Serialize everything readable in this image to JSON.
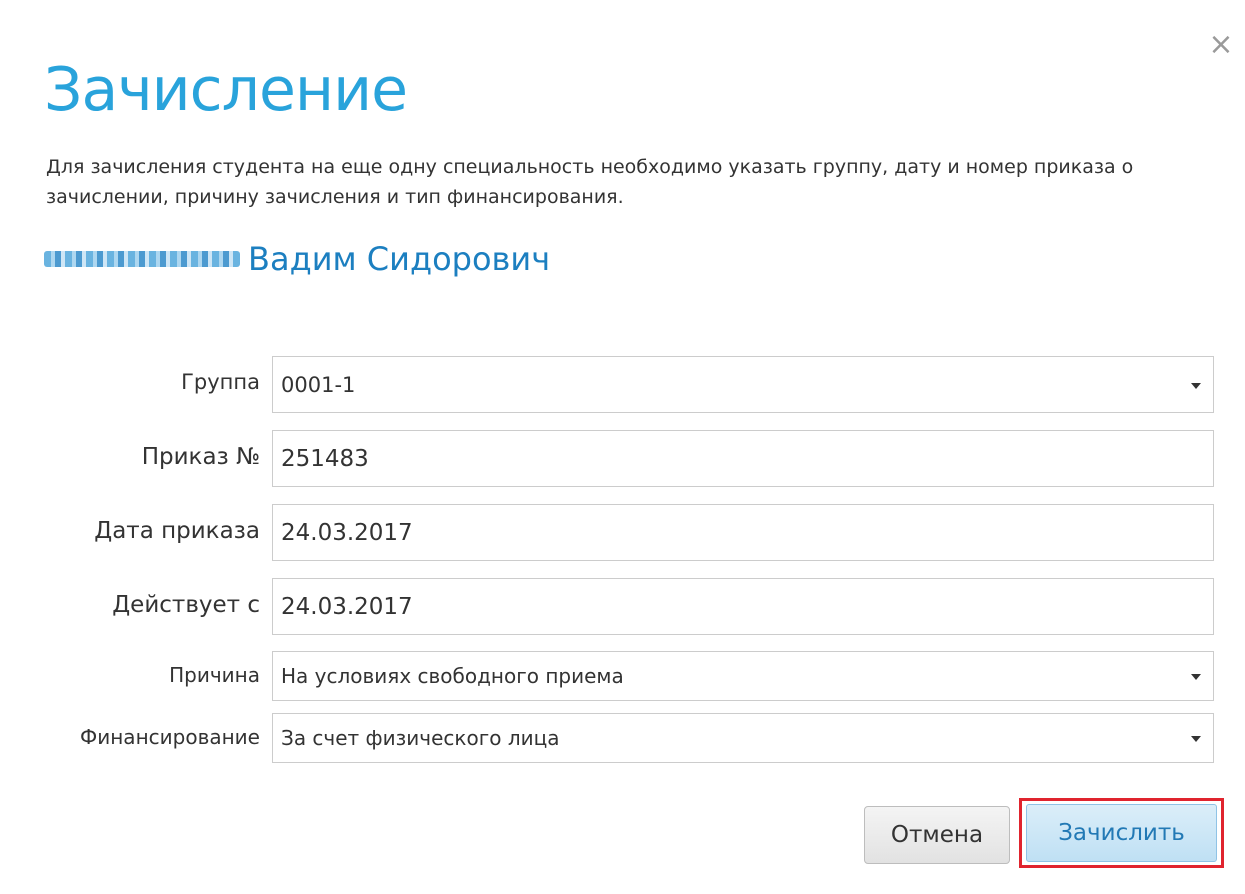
{
  "dialog": {
    "close_label": "×",
    "title": "Зачисление",
    "description": "Для зачисления студента на еще одну специальность необходимо указать группу, дату и номер приказа о зачислении, причину зачисления и тип финансирования.",
    "student_name": "Вадим Сидорович"
  },
  "form": {
    "group": {
      "label": "Группа",
      "value": "0001-1"
    },
    "order_number": {
      "label": "Приказ №",
      "value": "251483"
    },
    "order_date": {
      "label": "Дата приказа",
      "value": "24.03.2017"
    },
    "effective_from": {
      "label": "Действует с",
      "value": "24.03.2017"
    },
    "reason": {
      "label": "Причина",
      "value": "На условиях свободного приема"
    },
    "funding": {
      "label": "Финансирование",
      "value": "За счет физического лица"
    }
  },
  "buttons": {
    "cancel_label": "Отмена",
    "submit_label": "Зачислить"
  },
  "colors": {
    "title": "#29a3db",
    "name": "#1c7fc0",
    "highlight_border": "#e0242e"
  }
}
